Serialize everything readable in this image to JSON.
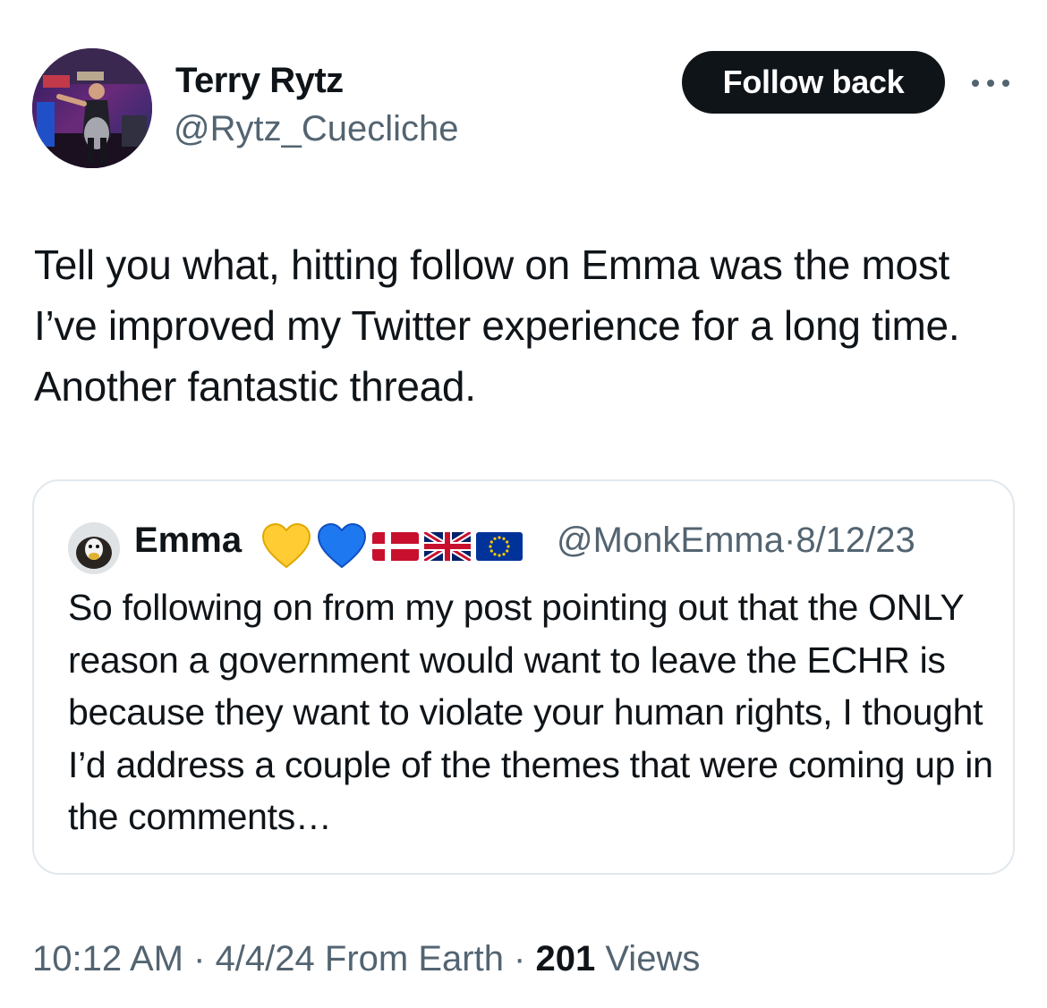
{
  "author": {
    "name": "Terry Rytz",
    "handle": "@Rytz_Cuecliche",
    "avatar_icon": "profile-photo-stage-performer"
  },
  "actions": {
    "follow_label": "Follow back",
    "more_icon": "more-horizontal-icon"
  },
  "tweet": {
    "text": "Tell you what, hitting follow on Emma was the most I’ve improved my Twitter experience for a long time. Another fantastic thread."
  },
  "quote": {
    "name": "Emma",
    "emojis": [
      "yellow-heart",
      "blue-heart",
      "flag-denmark",
      "flag-uk",
      "flag-eu"
    ],
    "handle": "@MonkEmma",
    "separator": "·",
    "date": "8/12/23",
    "text": "So following on from my post pointing out that the ONLY reason a government would want to leave the ECHR is because they want to violate your human rights, I thought I’d address a couple of the themes that were coming up in the comments…"
  },
  "footer": {
    "time": "10:12 AM",
    "sep1": " · ",
    "date": "4/4/24",
    "location": " From Earth",
    "sep2": " · ",
    "views_count": "201",
    "views_label": " Views"
  },
  "colors": {
    "text_primary": "#0f1419",
    "text_secondary": "#536471",
    "button_bg": "#0f1419",
    "border": "#e1e8ed"
  }
}
